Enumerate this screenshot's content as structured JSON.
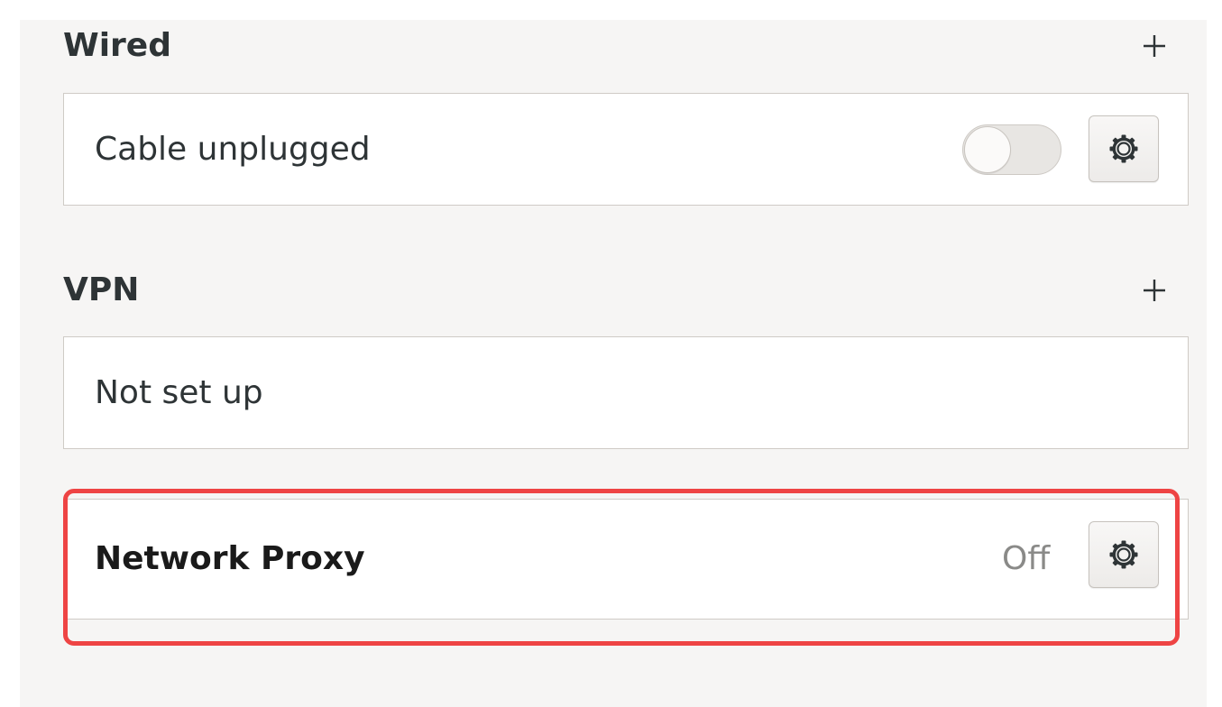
{
  "wired": {
    "title": "Wired",
    "add_icon": "plus-icon",
    "connection": {
      "label": "Cable unplugged",
      "toggle_state": "off",
      "settings_icon": "gear-icon"
    }
  },
  "vpn": {
    "title": "VPN",
    "add_icon": "plus-icon",
    "status_label": "Not set up"
  },
  "proxy": {
    "label": "Network Proxy",
    "status": "Off",
    "settings_icon": "gear-icon"
  },
  "colors": {
    "background": "#f6f5f4",
    "highlight": "#ee4444",
    "text": "#2e3436",
    "muted_text": "#8a8a88"
  }
}
